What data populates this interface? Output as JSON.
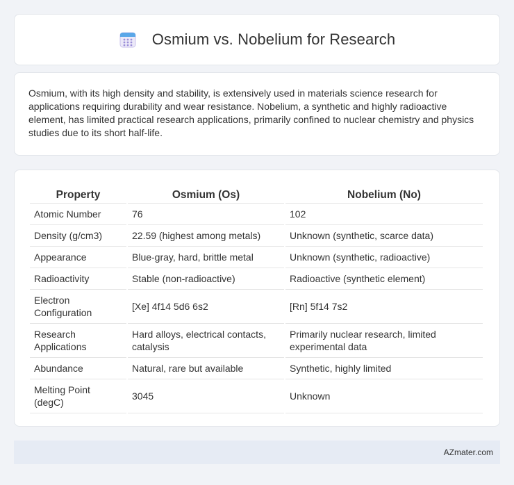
{
  "header": {
    "title": "Osmium vs. Nobelium for Research",
    "icon": "calendar-icon"
  },
  "intro": {
    "text": "Osmium, with its high density and stability, is extensively used in materials science research for applications requiring durability and wear resistance. Nobelium, a synthetic and highly radioactive element, has limited practical research applications, primarily confined to nuclear chemistry and physics studies due to its short half-life."
  },
  "table": {
    "headers": [
      "Property",
      "Osmium (Os)",
      "Nobelium (No)"
    ],
    "rows": [
      [
        "Atomic Number",
        "76",
        "102"
      ],
      [
        "Density (g/cm3)",
        "22.59 (highest among metals)",
        "Unknown (synthetic, scarce data)"
      ],
      [
        "Appearance",
        "Blue-gray, hard, brittle metal",
        "Unknown (synthetic, radioactive)"
      ],
      [
        "Radioactivity",
        "Stable (non-radioactive)",
        "Radioactive (synthetic element)"
      ],
      [
        "Electron Configuration",
        "[Xe] 4f14 5d6 6s2",
        "[Rn] 5f14 7s2"
      ],
      [
        "Research Applications",
        "Hard alloys, electrical contacts, catalysis",
        "Primarily nuclear research, limited experimental data"
      ],
      [
        "Abundance",
        "Natural, rare but available",
        "Synthetic, highly limited"
      ],
      [
        "Melting Point (degC)",
        "3045",
        "Unknown"
      ]
    ]
  },
  "footer": {
    "brand": "AZmater.com"
  },
  "colors": {
    "background": "#f1f3f7",
    "footer_bg": "#e6ebf4",
    "icon_accent": "#9b8fd8",
    "icon_top": "#5aa7e8"
  }
}
